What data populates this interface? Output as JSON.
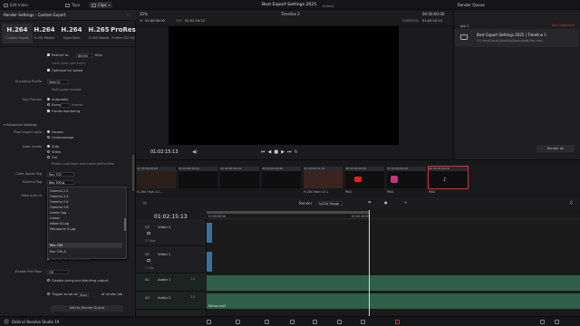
{
  "menubar": {
    "media_label": "Edit Index",
    "tape_label": "Tape",
    "clips_label": "Clips",
    "project_title": "Best Export Settings 2025",
    "edited": "Edited",
    "render_queue_title": "Render Queue"
  },
  "render_settings": {
    "title": "Render Settings - Custom Export",
    "presets": [
      {
        "big": "H.264",
        "small": "Custom Export"
      },
      {
        "big": "H.264",
        "small": "H.264 Master"
      },
      {
        "big": "H.264",
        "small": "HyperDeck"
      },
      {
        "big": "H.265",
        "small": "H.265 Master"
      },
      {
        "big": "ProRes",
        "small": "ProRes 422 HQ"
      }
    ],
    "restrict_to": "Restrict to",
    "restrict_value": "80000",
    "restrict_unit": "Kb/s",
    "limit_label": "Limit data rate every",
    "optimize": "Optimize for speed",
    "encoding_profile_label": "Encoding Profile",
    "encoding_profile_value": "Main10",
    "multipass": "Multi-pass encode",
    "key_frames_label": "Key Frames",
    "key_frames_auto": "Automatic",
    "key_frames_every": "Every",
    "key_frames_unit": "frames",
    "frame_reordering": "Frame reordering",
    "advanced_settings": "Advanced Settings",
    "pixel_aspect_label": "Pixel aspect ratio",
    "pixel_square": "Square",
    "pixel_cinemascope": "Cinemascope",
    "data_levels_label": "Data Levels",
    "data_auto": "Auto",
    "data_video": "Video",
    "data_full": "Full",
    "retain_sub": "Retain sub-black and super-white data",
    "color_space_label": "Color Space Tag",
    "color_space_value": "Rec.709",
    "gamma_tag_label": "Gamma Tag",
    "gamma_tag_value": "Rec.709-A",
    "burn_in_label": "Data burn-in",
    "dropdown_items": [
      "Gamma 2.2",
      "Gamma 2.4",
      "Gamma 2.6",
      "Gamma 2.8",
      "Linear Log",
      "Linear",
      "Nikon N-Log",
      "Panasonic V-Log",
      "Rec.709",
      "Rec.709-A"
    ],
    "render_all_video": "Render All Video Tracks",
    "enable_flat_pass_label": "Enable Flat Pass",
    "enable_flat_pass_value": "Off",
    "disable_sizing": "Disable sizing and blanking output",
    "trigger_script": "Trigger script at",
    "trigger_start": "Start",
    "trigger_of": "of render job",
    "add_to_queue": "Add to Render Queue"
  },
  "viewer": {
    "zoom": "35%",
    "in_label": "IN",
    "in_tc": "01:00:00:00",
    "out_label": "OUT",
    "out_tc": "01:02:15:13",
    "timeline_name": "Timeline 2",
    "timecode_right": "00:00:00:00",
    "duration_label": "DURATION",
    "duration_tc": "01:02:15:13",
    "transport_tc": "01:02:15:13"
  },
  "render_queue": {
    "job_label": "Job 1",
    "job_title": "Best Export Settings 2025 | Timeline 1",
    "job_path": "C:\\Users\\Daniel\\Desktop\\Downloads\\Test.mp4",
    "job_status": "Job Completed",
    "render_all": "Render All"
  },
  "clips": [
    {
      "num": "01",
      "tc": "00:00:00:00",
      "cap": "H.264 High 4:2..."
    },
    {
      "num": "02",
      "tc": "00:00:00:00",
      "cap": ""
    },
    {
      "num": "03",
      "tc": "00:00:00:00",
      "cap": ""
    },
    {
      "num": "04",
      "tc": "00:00:00:00",
      "cap": ""
    },
    {
      "num": "05",
      "tc": "00:09:52:19",
      "cap": "H.264 Main L5.1"
    },
    {
      "num": "06",
      "tc": "00:00:00:00",
      "cap": "PNG"
    },
    {
      "num": "07",
      "tc": "00:00:00:00",
      "cap": "PNG"
    },
    {
      "num": "08",
      "tc": "00:00:00:00",
      "cap": "PNG"
    }
  ],
  "timeline": {
    "timecode": "01:02:15:13",
    "render_label": "Render",
    "in_out_range": "In/Out Range",
    "ruler_start": "01:00:00:00",
    "ruler_mid": "01:00:49:00",
    "tracks": {
      "v2": {
        "id": "V2",
        "name": "Video 2",
        "clips": "2 Clips"
      },
      "v1": {
        "id": "V1",
        "name": "Video 1",
        "clips": "1 Clip"
      },
      "a1": {
        "id": "A1",
        "name": "Audio 1",
        "level": "1.0"
      },
      "a2": {
        "id": "A2",
        "name": "Audio 2",
        "level": "2.0"
      }
    },
    "audio_clip_name": "Rainon.mp3"
  },
  "bottom": {
    "app_name": "DaVinci Resolve Studio 19"
  },
  "colors": {
    "accent_red": "#c8353d",
    "video_clip": "#3a6f9f",
    "audio_clip": "#2f5f48"
  }
}
